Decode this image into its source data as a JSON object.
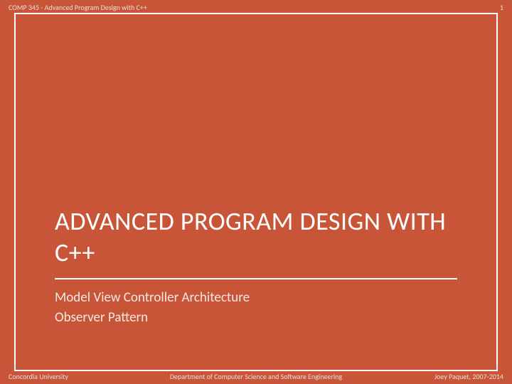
{
  "header": {
    "course": "COMP 345 - Advanced Program Design with C++",
    "page": "1"
  },
  "main": {
    "title": "ADVANCED PROGRAM DESIGN WITH C++",
    "subtitle_line1": "Model View Controller Architecture",
    "subtitle_line2": "Observer Pattern"
  },
  "footer": {
    "university": "Concordia University",
    "department": "Department of Computer Science and Software Engineering",
    "author": "Joey Paquet, 2007-2014"
  },
  "colors": {
    "background": "#c95539",
    "text": "#ffffff",
    "muted": "#eadfd8"
  }
}
